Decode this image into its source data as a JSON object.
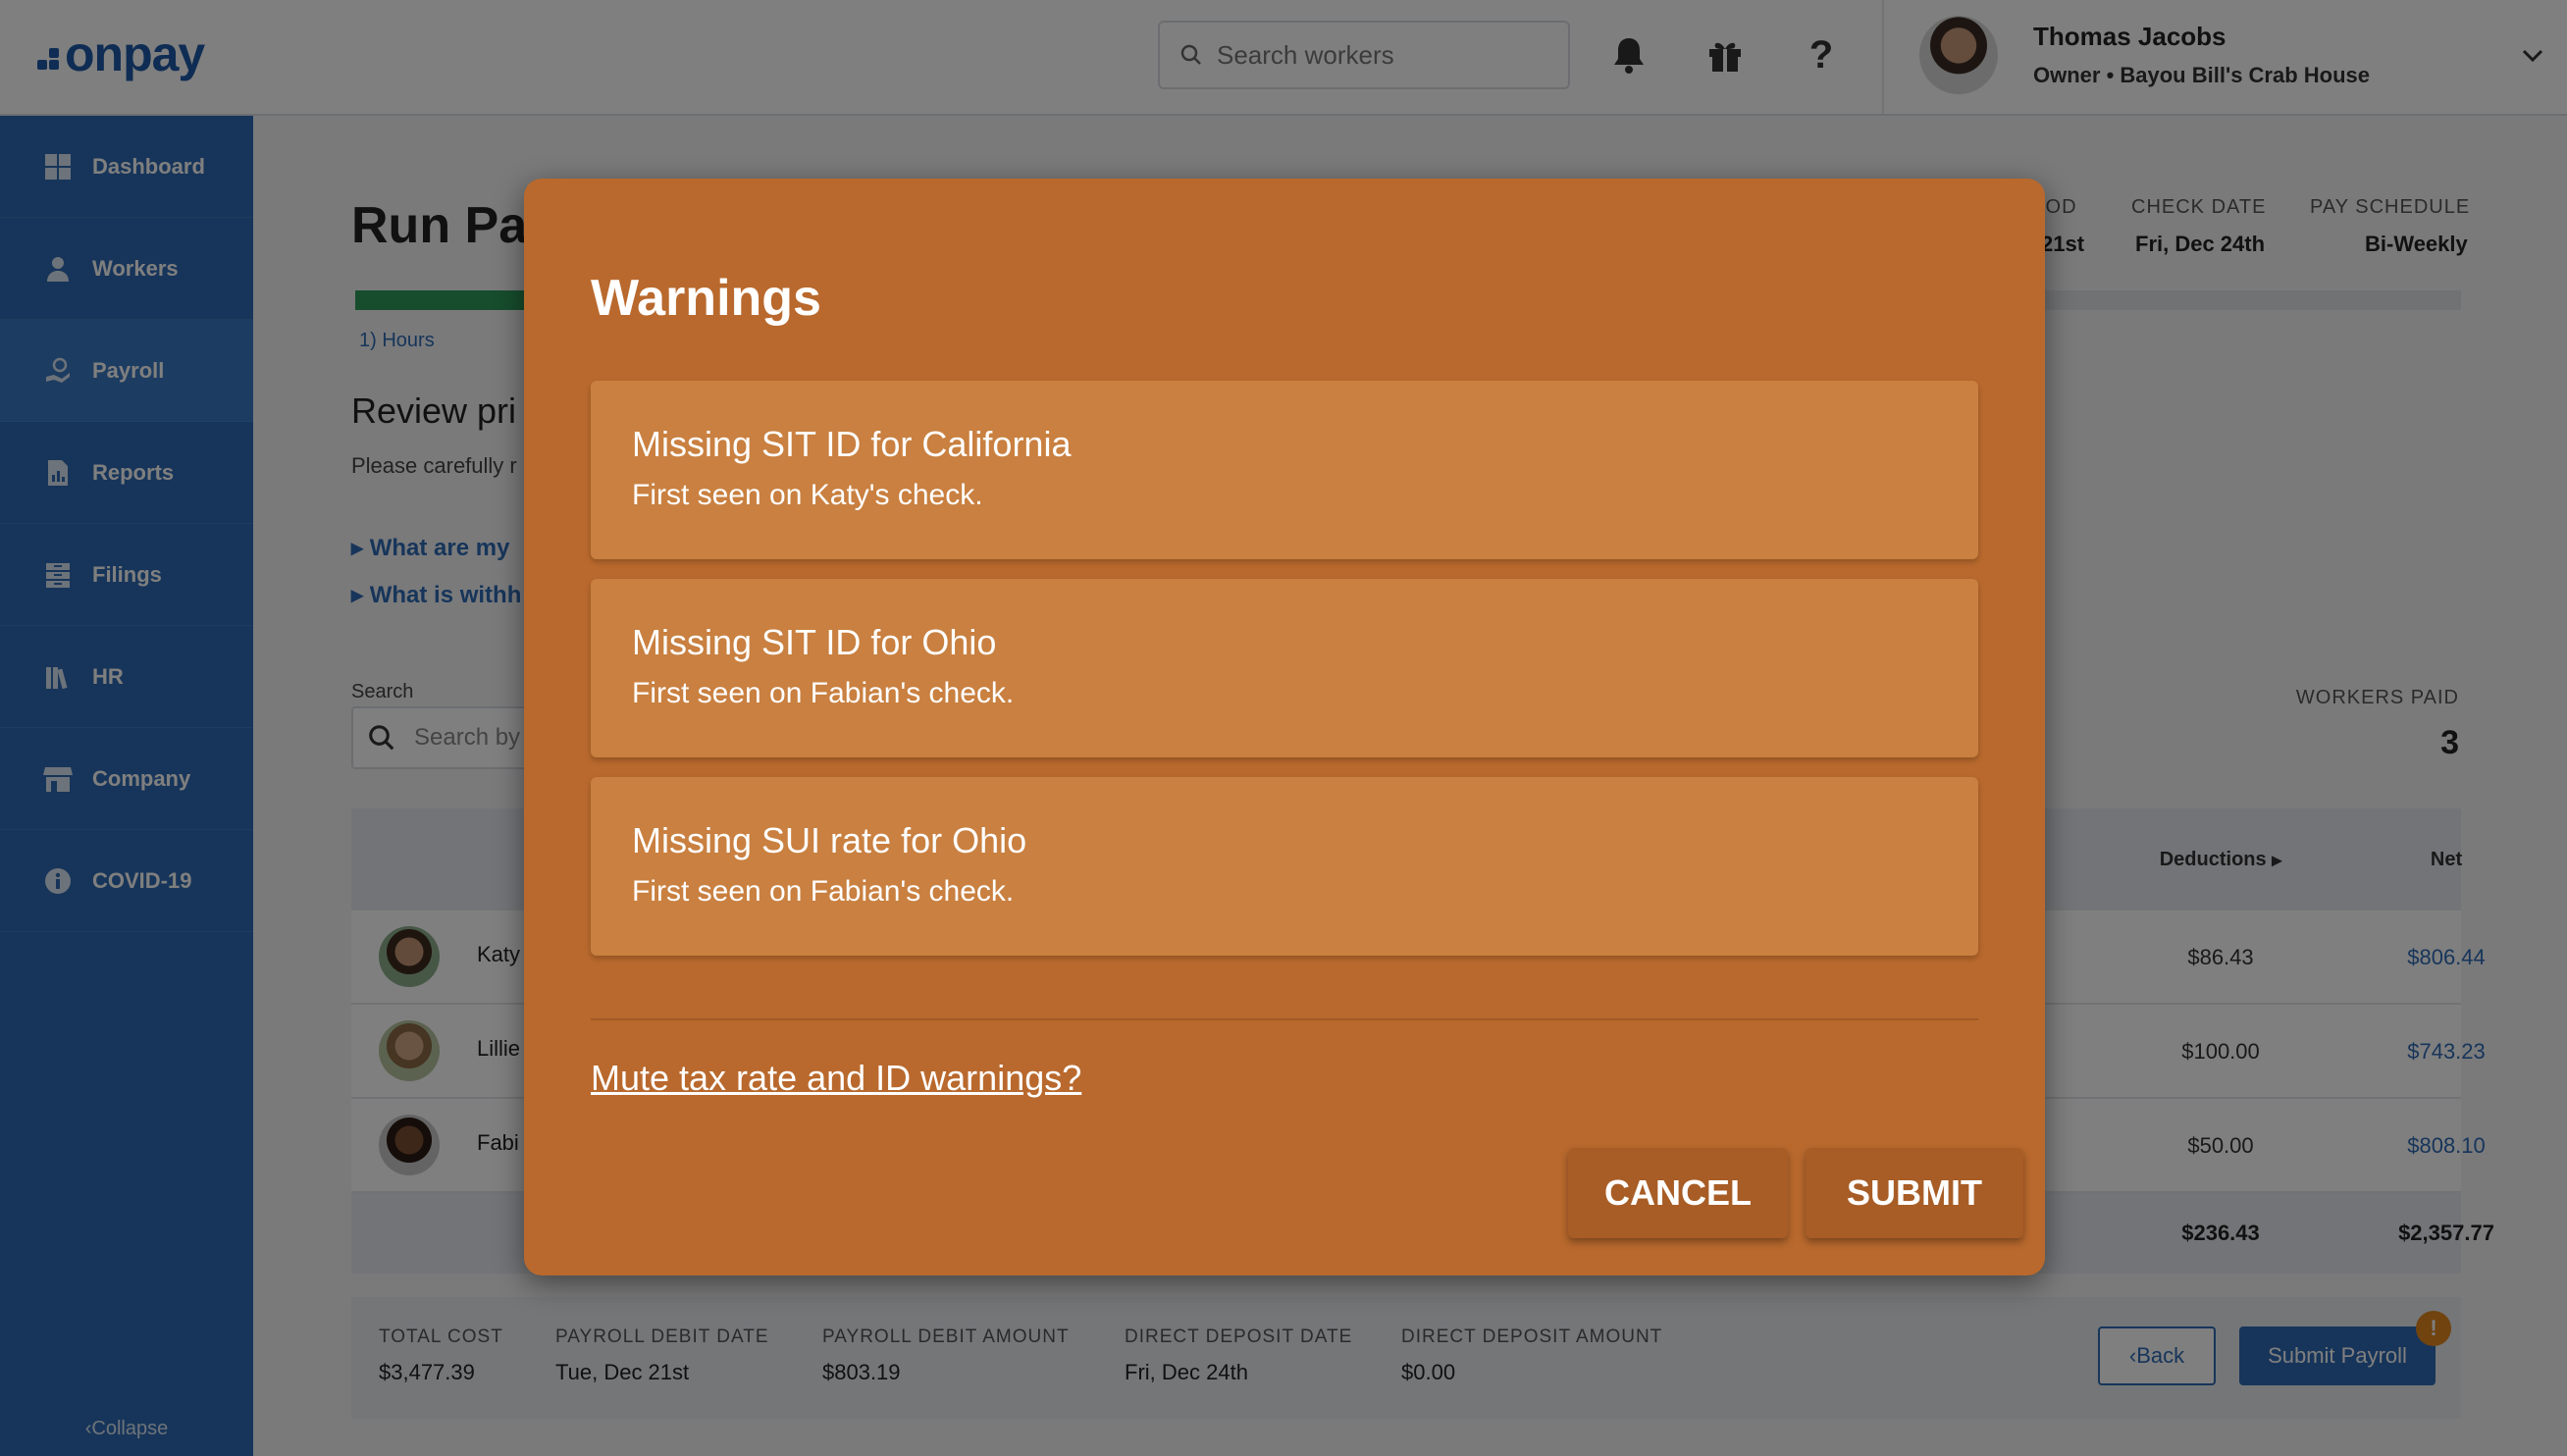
{
  "app": {
    "logo_text": "onpay"
  },
  "topbar": {
    "search_placeholder": "Search workers",
    "icons": [
      "bell-icon",
      "gift-icon",
      "help-icon"
    ],
    "user": {
      "name": "Thomas Jacobs",
      "subtitle": "Owner • Bayou Bill's Crab House"
    }
  },
  "sidebar": {
    "items": [
      {
        "label": "Dashboard",
        "icon": "dashboard-icon"
      },
      {
        "label": "Workers",
        "icon": "workers-icon"
      },
      {
        "label": "Payroll",
        "icon": "payroll-icon"
      },
      {
        "label": "Reports",
        "icon": "reports-icon"
      },
      {
        "label": "Filings",
        "icon": "filings-icon"
      },
      {
        "label": "HR",
        "icon": "hr-icon"
      },
      {
        "label": "Company",
        "icon": "company-icon"
      },
      {
        "label": "COVID-19",
        "icon": "info-icon"
      }
    ],
    "collapse_label": "Collapse"
  },
  "main": {
    "title": "Run Pay",
    "step_label": "1) Hours",
    "review_title": "Review pri",
    "review_desc": "Please carefully r",
    "faq": [
      "What are my",
      "What is withh"
    ],
    "header": {
      "period_label": "IOD",
      "period_value": "21st",
      "check_date_label": "CHECK DATE",
      "check_date_value": "Fri, Dec 24th",
      "pay_schedule_label": "PAY SCHEDULE",
      "pay_schedule_value": "Bi-Weekly"
    },
    "search_label": "Search",
    "search_placeholder": "Search by",
    "workers_paid_label": "WORKERS PAID",
    "workers_paid_value": "3",
    "table": {
      "columns": {
        "deductions": "Deductions",
        "net": "Net"
      },
      "rows": [
        {
          "name": "Katy",
          "deductions": "$86.43",
          "net": "$806.44"
        },
        {
          "name": "Lillie",
          "deductions": "$100.00",
          "net": "$743.23"
        },
        {
          "name": "Fabi",
          "deductions": "$50.00",
          "net": "$808.10"
        }
      ],
      "totals": {
        "deductions": "$236.43",
        "net": "$2,357.77"
      }
    },
    "footer": {
      "total_cost_label": "TOTAL COST",
      "total_cost": "$3,477.39",
      "debit_date_label": "PAYROLL DEBIT DATE",
      "debit_date": "Tue, Dec 21st",
      "debit_amount_label": "PAYROLL DEBIT AMOUNT",
      "debit_amount": "$803.19",
      "dd_date_label": "DIRECT DEPOSIT DATE",
      "dd_date": "Fri, Dec 24th",
      "dd_amount_label": "DIRECT DEPOSIT AMOUNT",
      "dd_amount": "$0.00",
      "back_label": "Back",
      "submit_label": "Submit Payroll",
      "alert_badge": "!"
    }
  },
  "modal": {
    "title": "Warnings",
    "warnings": [
      {
        "title": "Missing SIT ID for California",
        "subtitle": "First seen on Katy's check."
      },
      {
        "title": "Missing SIT ID for Ohio",
        "subtitle": "First seen on Fabian's check."
      },
      {
        "title": "Missing SUI rate for Ohio",
        "subtitle": "First seen on Fabian's check."
      }
    ],
    "mute_link": "Mute tax rate and ID warnings?",
    "cancel_label": "CANCEL",
    "submit_label": "SUBMIT"
  },
  "colors": {
    "brand_blue": "#2f6bb5",
    "modal_bg": "#b9692d",
    "warning_card": "#c98040",
    "progress_green": "#2e9a5a"
  }
}
